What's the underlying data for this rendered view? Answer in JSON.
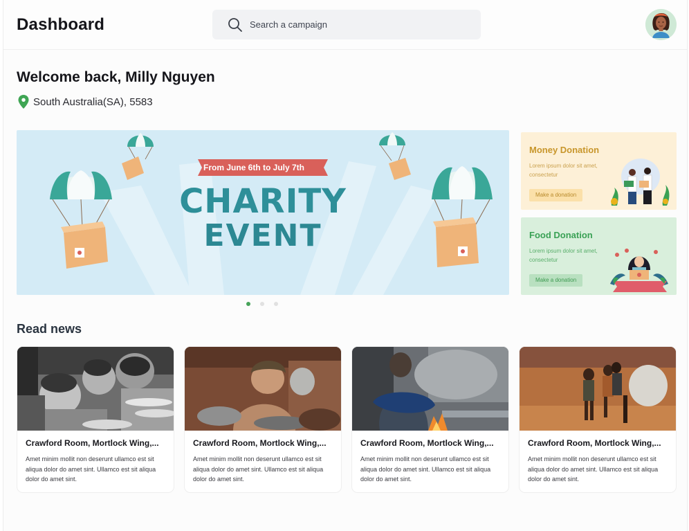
{
  "header": {
    "title": "Dashboard",
    "search_placeholder": "Search a campaign"
  },
  "welcome": {
    "greeting": "Welcome back, Milly Nguyen",
    "location": "South Australia(SA), 5583"
  },
  "banner": {
    "ribbon": "From June 6th to July 7th",
    "line1": "CHARITY",
    "line2": "EVENT",
    "slides": 3,
    "active_slide": 1
  },
  "donations": {
    "money": {
      "title": "Money Donation",
      "desc": "Lorem ipsum dolor sit amet, consectetur",
      "button": "Make a donation"
    },
    "food": {
      "title": "Food Donation",
      "desc": "Lorem ipsum dolor sit amet, consectetur",
      "button": "Make a donation"
    }
  },
  "news": {
    "section_title": "Read news",
    "items": [
      {
        "title": "Crawford Room, Mortlock Wing,...",
        "body": "Amet minim mollit non deserunt ullamco est sit aliqua dolor do amet sint. Ullamco est sit aliqua dolor do amet sint."
      },
      {
        "title": "Crawford Room, Mortlock Wing,...",
        "body": "Amet minim mollit non deserunt ullamco est sit aliqua dolor do amet sint. Ullamco est sit aliqua dolor do amet sint."
      },
      {
        "title": "Crawford Room, Mortlock Wing,...",
        "body": "Amet minim mollit non deserunt ullamco est sit aliqua dolor do amet sint. Ullamco est sit aliqua dolor do amet sint."
      },
      {
        "title": "Crawford Room, Mortlock Wing,...",
        "body": "Amet minim mollit non deserunt ullamco est sit aliqua dolor do amet sint. Ullamco est sit aliqua dolor do amet sint."
      }
    ]
  },
  "colors": {
    "banner_bg": "#d4ebf6",
    "charity_teal": "#2e8f99",
    "ribbon_red": "#d9605a",
    "money_bg": "#fdf0d7",
    "money_accent": "#c8962b",
    "food_bg": "#d9efdc",
    "food_accent": "#3aa155",
    "active_dot": "#47a35a"
  },
  "icons": [
    "search-icon",
    "location-pin-icon",
    "user-avatar"
  ]
}
